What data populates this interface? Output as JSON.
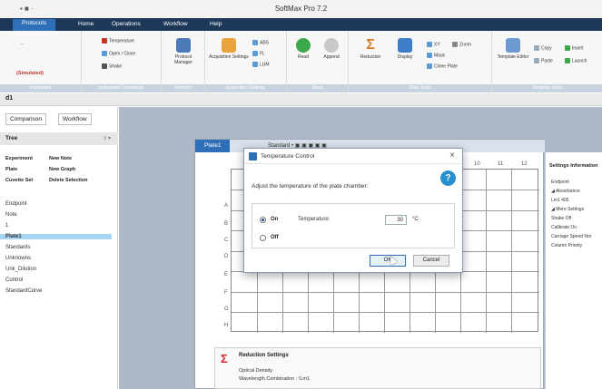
{
  "window": {
    "title": "SoftMax Pro 7.2",
    "quick_access": "▪ ■ ·"
  },
  "menu": {
    "items": [
      "Protocols",
      "Home",
      "Operations",
      "Workflow",
      "Help"
    ],
    "active": "Protocols"
  },
  "ribbon": {
    "emulated": "(Simulated)",
    "group_labels": [
      "Instrument",
      "Instrument Commands",
      "Protocol",
      "Acquisition Settings",
      "Read",
      "Data Tools",
      "Template Tools"
    ],
    "temperature": "Temperature",
    "open_close": "Open / Close",
    "shake": "Shake",
    "protocol_manager": "Protocol Manager",
    "acquisition_settings": "Acquisition Settings",
    "acq_options": [
      "ABS",
      "FL",
      "LUM"
    ],
    "read": "Read",
    "append": "Append",
    "reduction": "Reduction",
    "display": "Display",
    "data_tools": [
      "XY",
      "Zoom",
      "Mask",
      "Clone Plate"
    ],
    "template_editor": "Template Editor",
    "template_tools": [
      "Copy",
      "Insert",
      "Paste",
      "Launch"
    ]
  },
  "doc_tab": "d1",
  "left_panel": {
    "tabs": [
      "Comparison",
      "Workflow"
    ],
    "tree_header": "Tree",
    "tree_header_right": "≡ ▾",
    "actions": [
      {
        "left": "Experiment",
        "right": "New Note"
      },
      {
        "left": "Plate",
        "right": "New Graph"
      },
      {
        "left": "Cuvette Set",
        "right": "Delete Selection"
      }
    ],
    "items": [
      "Endpoint",
      "Note",
      "1",
      "Plate1",
      "Standards",
      "Unknowns",
      "Unk_Dilution",
      "Control",
      "StandardCurve"
    ],
    "selected_index": 3
  },
  "plate": {
    "tab_title": "Plate1",
    "tab_options": "Standard • ▣ ▣ ▣ ▣ ▣",
    "rows": [
      "A",
      "B",
      "C",
      "D",
      "E",
      "F",
      "G",
      "H"
    ],
    "cols": [
      "10",
      "11",
      "12"
    ]
  },
  "settings_panel": {
    "heading": "Settings Information",
    "lines": [
      "Endpoint",
      "◢ Absorbance",
      "Lm1  405",
      "◢ More Settings",
      "Shake  Off",
      "Calibrate  On",
      "Carriage Speed  Nor",
      "Column Priority"
    ]
  },
  "reduction_panel": {
    "title": "Reduction Settings",
    "line1": "Optical Density",
    "line2": "Wavelength Combination : !Lm1"
  },
  "dialog": {
    "title": "Temperature Control",
    "close_glyph": "×",
    "message": "Adjust the temperature of the plate chamber:",
    "help_glyph": "?",
    "option_on": "On",
    "option_off": "Off",
    "selected": "On",
    "temperature_label": "Temperature:",
    "temperature_value": "30",
    "unit": "°C",
    "ok": "OK",
    "cancel": "Cancel"
  }
}
